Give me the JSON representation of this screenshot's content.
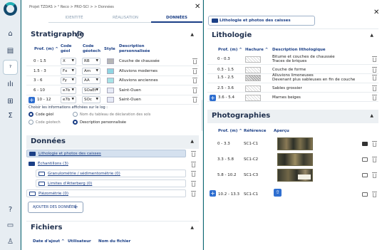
{
  "sidebar": {
    "icons": [
      "home-icon",
      "calendar-icon",
      "route-icon",
      "chart-icon",
      "drill-icon",
      "sum-icon",
      "help-icon",
      "chat-icon",
      "user-icon"
    ]
  },
  "left": {
    "breadcrumb": "Projet TZDAS > ⁰ Reco > PRO-SCI > > Données",
    "tabs": [
      {
        "label": "IDENTITÉ"
      },
      {
        "label": "RÉALISATION"
      },
      {
        "label": "DONNÉES"
      }
    ],
    "stratigraphie": {
      "title": "Stratigraphie",
      "headers": {
        "prof": "Prof. (m) ^",
        "code_geol": "Code géol",
        "code_geotech": "Code géotech",
        "style": "Style",
        "description": "Description personnalisée"
      },
      "rows": [
        {
          "prof": "0 - 1.5",
          "geol": "X",
          "geotech": "RB",
          "color": "#b6b6b6",
          "desc": "Couche de chaussée"
        },
        {
          "prof": "1.5 - 3",
          "geol": "Fx",
          "geotech": "Am",
          "color": "#8fd5e2",
          "desc": "Alluvions modernes"
        },
        {
          "prof": "3 - 6",
          "geol": "Fy",
          "geotech": "AA",
          "color": "#a7e3e6",
          "desc": "Alluvions anciennes"
        },
        {
          "prof": "6 - 10",
          "geol": "e7b",
          "geotech": "SOaEt",
          "color": "#e6eaf6",
          "desc": "Saint-Ouen"
        },
        {
          "prof": "10 - 12",
          "geol": "e7b",
          "geotech": "SOc",
          "color": "#e6eaf6",
          "desc": "Saint-Ouen"
        }
      ],
      "options_label": "Choisir les informations affichées sur le log :",
      "options": [
        {
          "label": "Code géol",
          "on": true
        },
        {
          "label": "Nom du tableau de déclaration des sols",
          "on": false
        },
        {
          "label": "Code géotech",
          "on": false
        },
        {
          "label": "Description personnalisée",
          "on": true
        }
      ]
    },
    "donnees": {
      "title": "Données",
      "items": [
        "Lithologie et photos des caisses",
        "Échantillons (3)",
        "Granulométrie / sédimentométrie (0)",
        "Limites d'Atterberg (0)",
        "Piézométrie (0)"
      ],
      "add_label": "AJOUTER DES DONNÉES",
      "add_icon": "+"
    },
    "fichiers": {
      "title": "Fichiers",
      "col1": "Date d'ajout ^",
      "col2": "Utilisateur",
      "col3": "Nom du fichier"
    }
  },
  "right": {
    "top_button": "Lithologie et photos des caisses",
    "lithologie": {
      "title": "Lithologie",
      "headers": {
        "prof": "Prof. (m) ^",
        "hachure": "Hachure ^",
        "desc": "Description lithologique"
      },
      "rows": [
        {
          "prof": "0 - 0.3",
          "desc": "Bitume et couches de chaussée",
          "desc2": "Traces de briques",
          "dark": false
        },
        {
          "prof": "0.3 - 1.5",
          "desc": "Couche de forme",
          "desc2": "",
          "dark": false
        },
        {
          "prof": "1.5 - 2.5",
          "desc": "Alluvions limoneuses",
          "desc2": "Devenant plus sableuses en fin de couche",
          "dark": true
        },
        {
          "prof": "2.5 - 3.6",
          "desc": "Sables grossier",
          "desc2": "",
          "dark": false
        },
        {
          "prof": "3.6 - 5.4",
          "desc": "Marnes beiges",
          "desc2": "",
          "dark": false
        }
      ]
    },
    "photos": {
      "title": "Photographies",
      "headers": {
        "prof": "Prof. (m) ^",
        "ref": "Référence",
        "apercu": "Aperçu"
      },
      "rows": [
        {
          "prof": "0 - 3.3",
          "ref": "SC1-C1"
        },
        {
          "prof": "3.3 - 5.8",
          "ref": "SC1-C2"
        },
        {
          "prof": "5.8 - 10.2",
          "ref": "SC1-C3"
        },
        {
          "prof": "10.2 - 13.3",
          "ref": "SC1-C1"
        }
      ]
    }
  }
}
